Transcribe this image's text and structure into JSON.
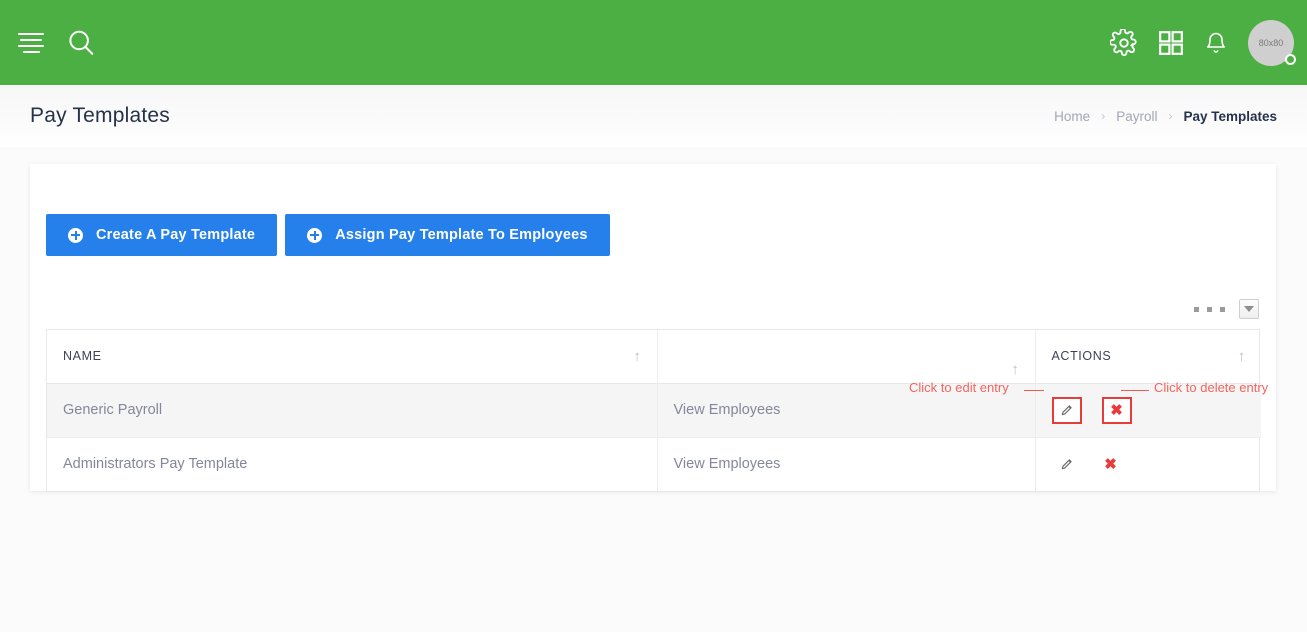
{
  "header": {
    "background_color": "#4caf44",
    "menu_icon": "hamburger-icon",
    "search_icon": "search-icon",
    "settings_icon": "gear-icon",
    "apps_icon": "grid-icon",
    "notifications_icon": "bell-icon",
    "avatar_label": "80x80"
  },
  "page": {
    "title": "Pay Templates"
  },
  "breadcrumb": {
    "separator": "›",
    "items": [
      {
        "label": "Home",
        "active": false
      },
      {
        "label": "Payroll",
        "active": false
      },
      {
        "label": "Pay Templates",
        "active": true
      }
    ]
  },
  "toolbar": {
    "create_button": "Create A Pay Template",
    "assign_button": "Assign Pay Template To Employees",
    "accent_color": "#2680eb",
    "dropdown_icon": "caret-down-icon",
    "overflow_icon": "ellipsis-icon"
  },
  "table": {
    "columns": [
      {
        "label": "NAME",
        "sort_icon": "sort-asc-arrow"
      },
      {
        "label": "",
        "sort_icon": "sort-asc-arrow"
      },
      {
        "label": "ACTIONS",
        "sort_icon": "sort-asc-arrow"
      }
    ],
    "rows": [
      {
        "name": "Generic Payroll",
        "employees_link": "View Employees",
        "edit_icon": "pencil-icon",
        "delete_icon": "x-delete-icon",
        "highlighted": true
      },
      {
        "name": "Administrators Pay Template",
        "employees_link": "View Employees",
        "edit_icon": "pencil-icon",
        "delete_icon": "x-delete-icon",
        "highlighted": false
      }
    ]
  },
  "annotations": {
    "color": "#f4655f",
    "edit_label": "Click to edit entry",
    "delete_label": "Click to delete entry"
  }
}
